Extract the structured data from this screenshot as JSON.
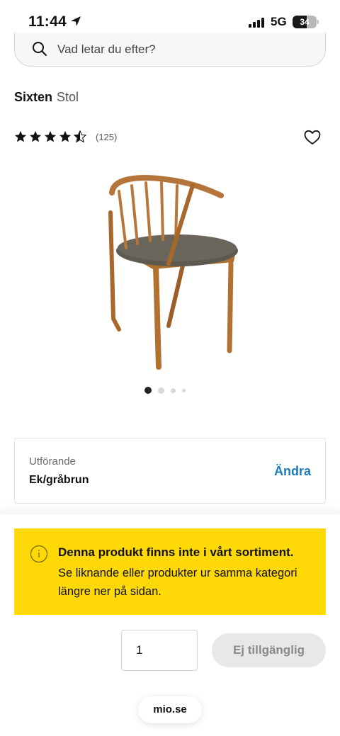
{
  "status_bar": {
    "time": "11:44",
    "network": "5G",
    "battery": "34"
  },
  "search": {
    "placeholder": "Vad letar du efter?"
  },
  "product": {
    "brand": "Sixten",
    "type": "Stol",
    "rating": 4.5,
    "review_count": "(125)",
    "image_icon": "chair-photo",
    "image_count": 4,
    "active_image": 1
  },
  "variant": {
    "label": "Utförande",
    "value": "Ek/gråbrun",
    "change_label": "Ändra"
  },
  "notice": {
    "title": "Denna produkt finns inte i vårt sortiment.",
    "body": "Se liknande eller produkter ur samma kategori längre ner på sidan.",
    "color": "#ffd808"
  },
  "purchase": {
    "quantity": "1",
    "button_label": "Ej tillgänglig"
  },
  "browser": {
    "url": "mio.se"
  },
  "colors": {
    "accent_link": "#1a7bbd",
    "notice_bg": "#ffd808"
  }
}
